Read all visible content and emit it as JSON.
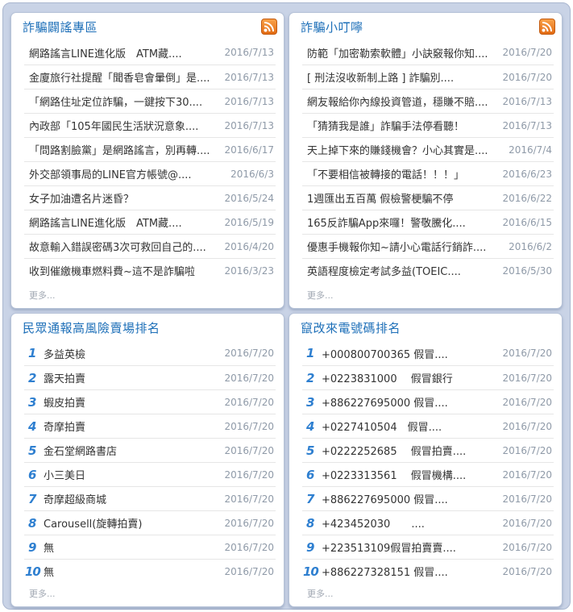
{
  "panels": {
    "fraud_rumors": {
      "title": "詐騙闢謠專區",
      "more": "更多...",
      "items": [
        {
          "text": "網路謠言LINE進化版　ATM藏....",
          "date": "2016/7/13"
        },
        {
          "text": "金廈旅行社提醒「聞香皂會暈倒」是....",
          "date": "2016/7/13"
        },
        {
          "text": "「網路住址定位詐騙，一鍵按下30....",
          "date": "2016/7/13"
        },
        {
          "text": "內政部「105年國民生活狀況意象....",
          "date": "2016/7/13"
        },
        {
          "text": "「問路割臉黨」是網路謠言，別再轉....",
          "date": "2016/6/17"
        },
        {
          "text": "外交部領事局的LINE官方帳號@....",
          "date": "2016/6/3"
        },
        {
          "text": "女子加油遭名片迷昏？",
          "date": "2016/5/24"
        },
        {
          "text": "網路謠言LINE進化版　ATM藏....",
          "date": "2016/5/19"
        },
        {
          "text": "故意輸入錯誤密碼3次可救回自己的....",
          "date": "2016/4/20"
        },
        {
          "text": "收到催繳機車燃料費~這不是詐騙啦",
          "date": "2016/3/23"
        }
      ]
    },
    "fraud_tips": {
      "title": "詐騙小叮嚀",
      "more": "更多...",
      "items": [
        {
          "text": "防範「加密勒索軟體」小訣竅報你知....",
          "date": "2016/7/20"
        },
        {
          "text": "[ 刑法沒收新制上路 ] 詐騙別....",
          "date": "2016/7/20"
        },
        {
          "text": "網友報給你內線投資管道，穩賺不賠....",
          "date": "2016/7/13"
        },
        {
          "text": "「猜猜我是誰」詐騙手法停看聽！",
          "date": "2016/7/13"
        },
        {
          "text": "天上掉下來的賺錢機會？小心其實是....",
          "date": "2016/7/4"
        },
        {
          "text": "「不要相信被轉接的電話！！！」",
          "date": "2016/6/23"
        },
        {
          "text": "1週匯出五百萬 假檢警梗騙不停",
          "date": "2016/6/22"
        },
        {
          "text": "165反詐騙App來囉！警敬騰化....",
          "date": "2016/6/15"
        },
        {
          "text": "優惠手機報你知~請小心電話行銷詐....",
          "date": "2016/6/2"
        },
        {
          "text": "英語程度檢定考試多益(TOEIC....",
          "date": "2016/5/30"
        }
      ]
    },
    "risky_stores": {
      "title": "民眾通報高風險賣場排名",
      "more": "更多...",
      "items": [
        {
          "rank": "1",
          "text": "多益英檢",
          "date": "2016/7/20"
        },
        {
          "rank": "2",
          "text": "露天拍賣",
          "date": "2016/7/20"
        },
        {
          "rank": "3",
          "text": "蝦皮拍賣",
          "date": "2016/7/20"
        },
        {
          "rank": "4",
          "text": "奇摩拍賣",
          "date": "2016/7/20"
        },
        {
          "rank": "5",
          "text": "金石堂網路書店",
          "date": "2016/7/20"
        },
        {
          "rank": "6",
          "text": "小三美日",
          "date": "2016/7/20"
        },
        {
          "rank": "7",
          "text": "奇摩超級商城",
          "date": "2016/7/20"
        },
        {
          "rank": "8",
          "text": "Carousell(旋轉拍賣)",
          "date": "2016/7/20"
        },
        {
          "rank": "9",
          "text": "無",
          "date": "2016/7/20"
        },
        {
          "rank": "10",
          "text": "無",
          "date": "2016/7/20"
        }
      ]
    },
    "spoofed_numbers": {
      "title": "竄改來電號碼排名",
      "more": "更多...",
      "items": [
        {
          "rank": "1",
          "text": "+000800700365 假冒....",
          "date": "2016/7/20"
        },
        {
          "rank": "2",
          "text": "+0223831000　 假冒銀行",
          "date": "2016/7/20"
        },
        {
          "rank": "3",
          "text": "+886227695000 假冒....",
          "date": "2016/7/20"
        },
        {
          "rank": "4",
          "text": "+0227410504　假冒....",
          "date": "2016/7/20"
        },
        {
          "rank": "5",
          "text": "+0222252685　 假冒拍賣....",
          "date": "2016/7/20"
        },
        {
          "rank": "6",
          "text": "+0223313561　 假冒機構....",
          "date": "2016/7/20"
        },
        {
          "rank": "7",
          "text": "+886227695000 假冒....",
          "date": "2016/7/20"
        },
        {
          "rank": "8",
          "text": "+423452030　　....",
          "date": "2016/7/20"
        },
        {
          "rank": "9",
          "text": "+223513109假冒拍賣賣....",
          "date": "2016/7/20"
        },
        {
          "rank": "10",
          "text": "+886227328151 假冒....",
          "date": "2016/7/20"
        }
      ]
    }
  },
  "icons": {
    "rss": "rss-feed-icon"
  },
  "colors": {
    "title": "#1d6fb8",
    "rank": "#2e7fd0",
    "date": "#8f9aa8",
    "rss": "#e36b12",
    "frame": "#c9d3e6"
  }
}
